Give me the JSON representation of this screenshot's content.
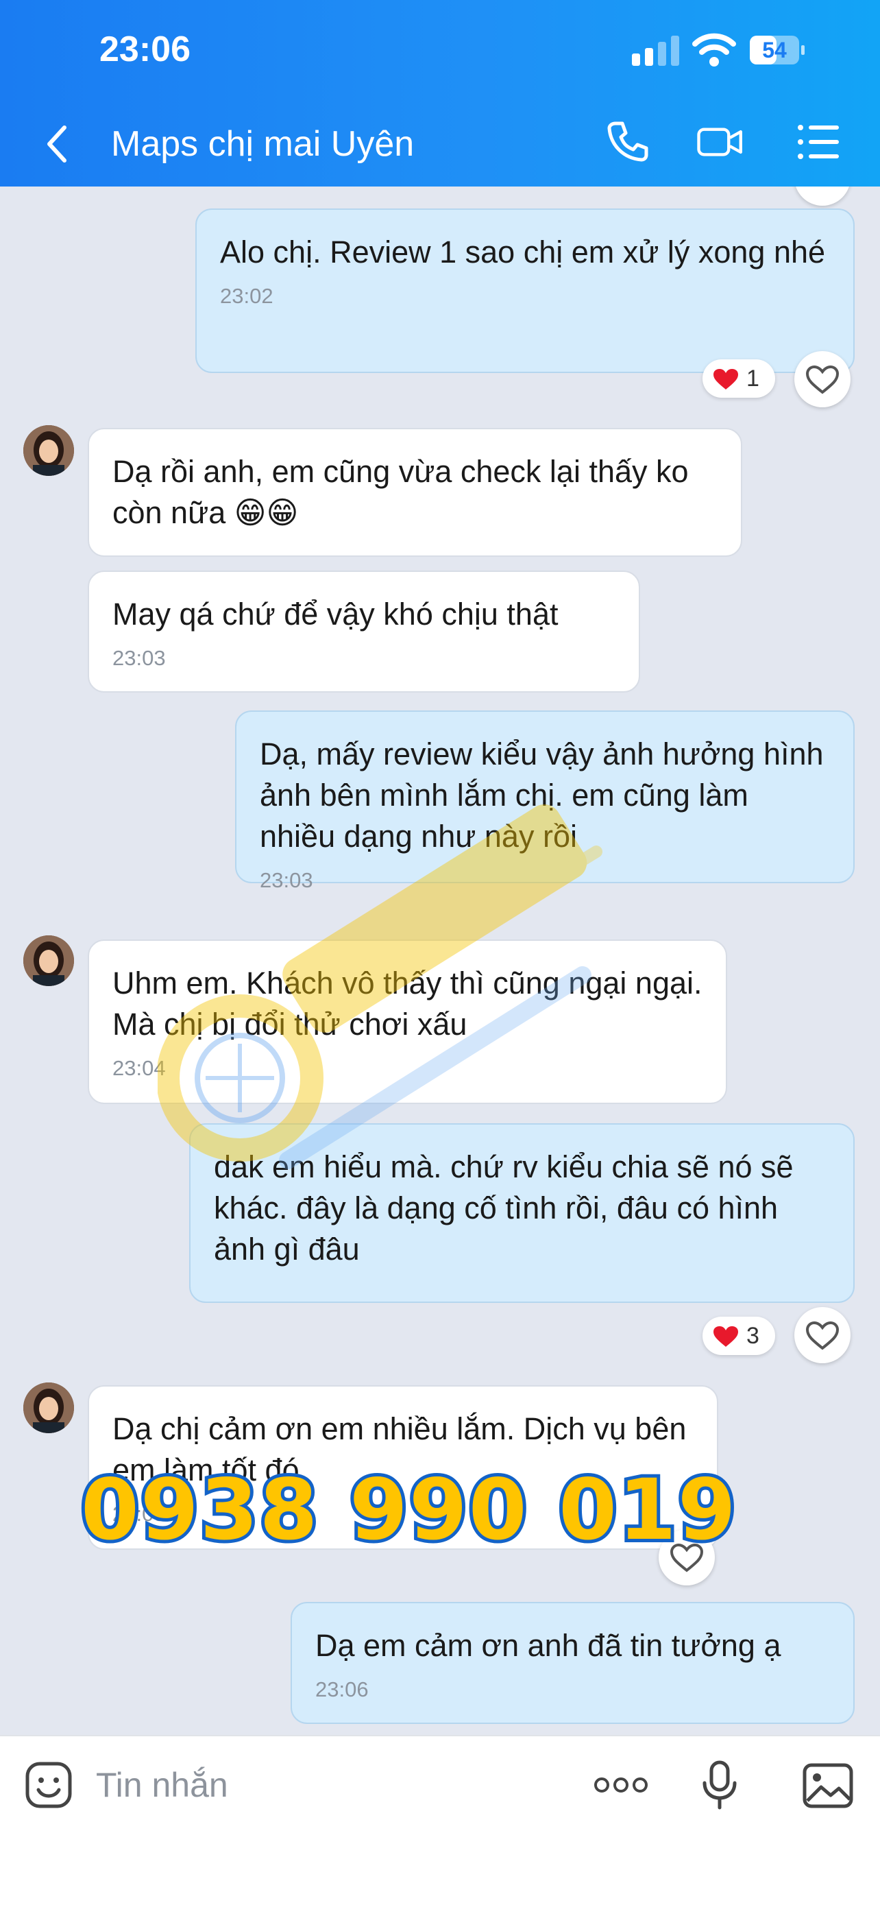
{
  "status": {
    "time": "23:06",
    "battery": "54",
    "battery_level": 0.54
  },
  "header": {
    "title": "Maps chị mai Uyên",
    "icons": [
      "back-icon",
      "phone-icon",
      "video-icon",
      "menu-icon"
    ]
  },
  "messages": [
    {
      "dir": "out",
      "text": "Alo chị. Review 1 sao chị em xử lý xong nhé",
      "time": "23:02",
      "reaction": "1"
    },
    {
      "dir": "in",
      "text": "Dạ rồi anh, em cũng vừa check lại thấy ko còn nữa 😁😁",
      "time": ""
    },
    {
      "dir": "in",
      "text": "May qá chứ để vậy khó chịu thật",
      "time": "23:03"
    },
    {
      "dir": "out",
      "text": "Dạ, mấy review kiểu vậy ảnh hưởng hình ảnh bên mình lắm chị. em cũng làm nhiều dạng như này rồi",
      "time": "23:03"
    },
    {
      "dir": "in",
      "text": "Uhm em. Khách vô thấy thì cũng ngại ngại. Mà chị bị đổi thử chơi xấu",
      "time": "23:04"
    },
    {
      "dir": "out",
      "text": "dak em hiểu mà. chứ rv kiểu chia sẽ nó sẽ khác. đây là dạng cố tình rồi, đâu có hình ảnh gì đâu",
      "time": "",
      "reaction": "3"
    },
    {
      "dir": "in",
      "text": "Dạ chị cảm ơn em nhiều lắm. Dịch vụ bên em làm tốt đó",
      "time": "23:05"
    },
    {
      "dir": "out",
      "text": "Dạ em cảm ơn anh đã tin tưởng ạ",
      "time": "23:06"
    }
  ],
  "overlay": {
    "phone": "0938 990 019"
  },
  "input": {
    "placeholder": "Tin nhắn"
  },
  "colors": {
    "header": "#1a7cf2",
    "outgoing_bubble": "#d5ecfc",
    "incoming_bubble": "#ffffff",
    "chat_bg": "#e3e7f0",
    "reaction_heart": "#e8192c",
    "overlay_text": "#ffc400"
  }
}
